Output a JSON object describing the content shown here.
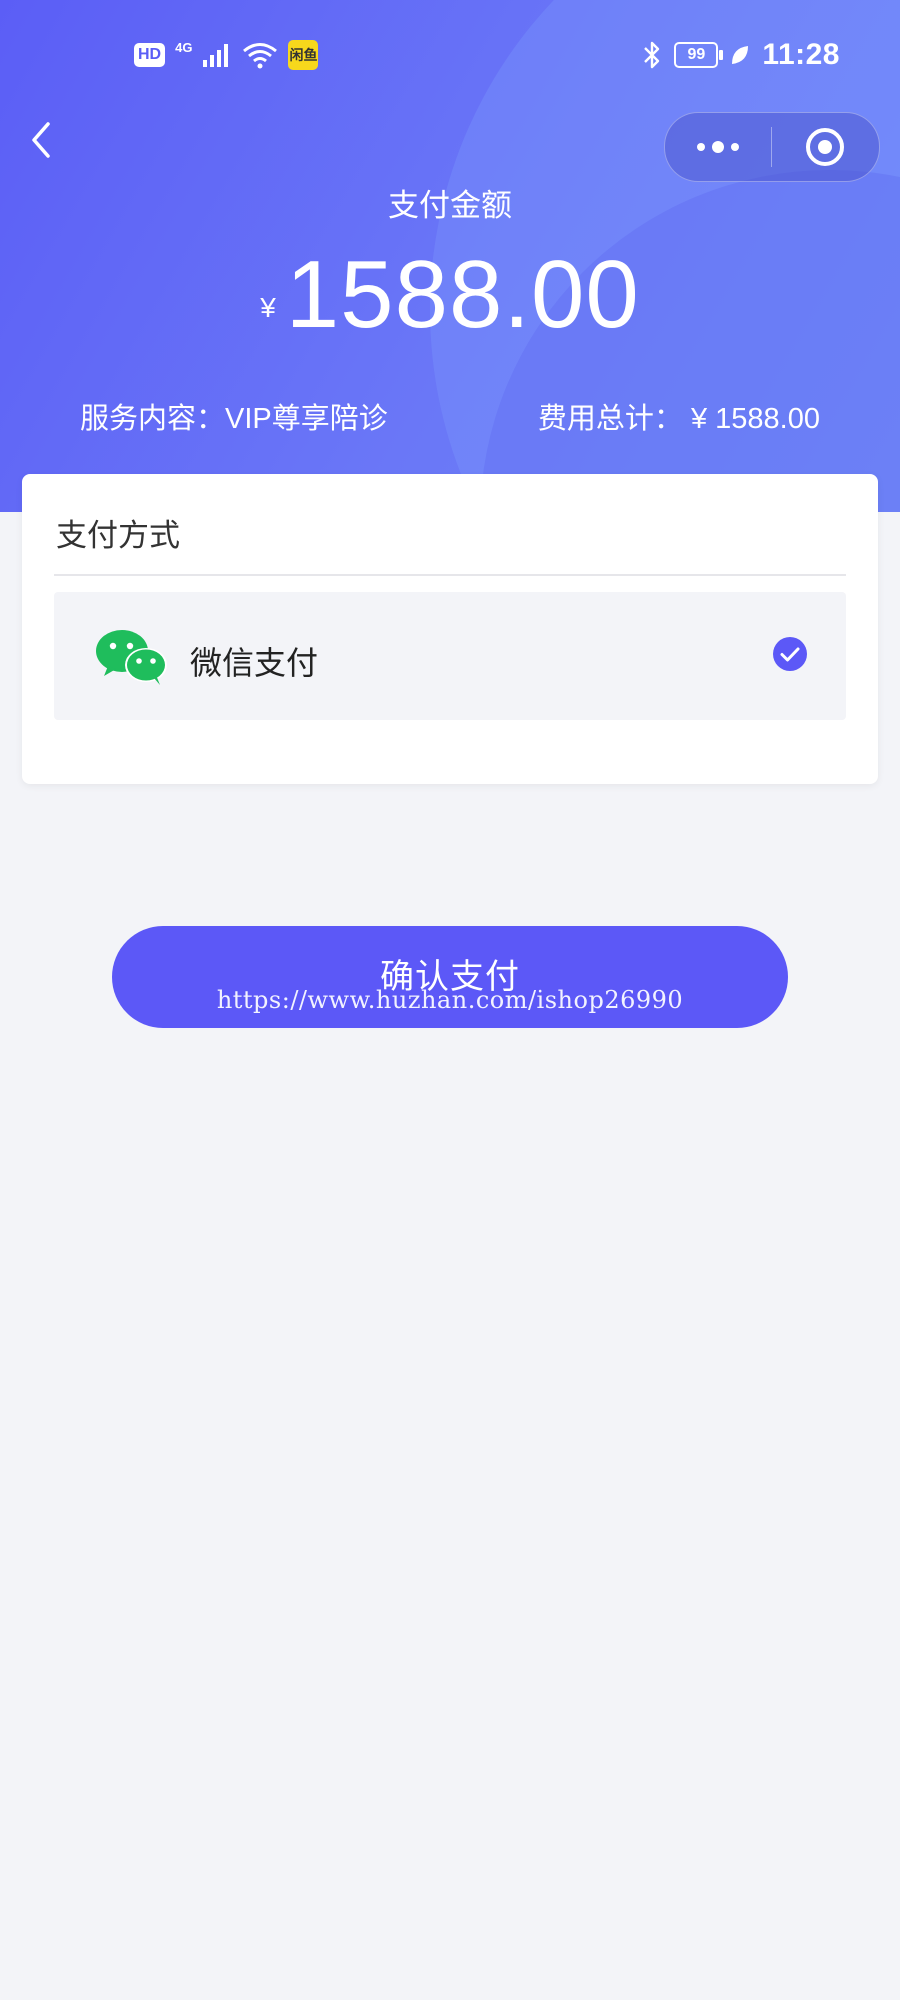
{
  "status_bar": {
    "hd": "HD",
    "network": "4G",
    "yellow_badge": "闲鱼",
    "battery": "99",
    "time": "11:28",
    "icons": [
      "signal-icon",
      "wifi-icon",
      "bluetooth-icon",
      "leaf-icon"
    ]
  },
  "nav": {
    "back_icon": "chevron-left-icon",
    "more_icon": "more-dots-icon",
    "close_icon": "target-circle-icon"
  },
  "payment": {
    "label": "支付金额",
    "currency": "¥",
    "amount": "1588.00",
    "service_text": "服务内容：VIP尊享陪诊",
    "total_text": "费用总计： ¥ 1588.00"
  },
  "method_card": {
    "title": "支付方式",
    "option_label": "微信支付",
    "option_icon": "wechat-icon",
    "selected": true,
    "check_icon": "check-circle-icon"
  },
  "confirm_button": {
    "label": "确认支付"
  },
  "watermark": "https://www.huzhan.com/ishop26990",
  "colors": {
    "primary": "#5c58f7",
    "header_start": "#5b5ef6",
    "header_end": "#6f86f8",
    "background": "#f3f4f8",
    "wechat_green": "#1fbd5c"
  }
}
